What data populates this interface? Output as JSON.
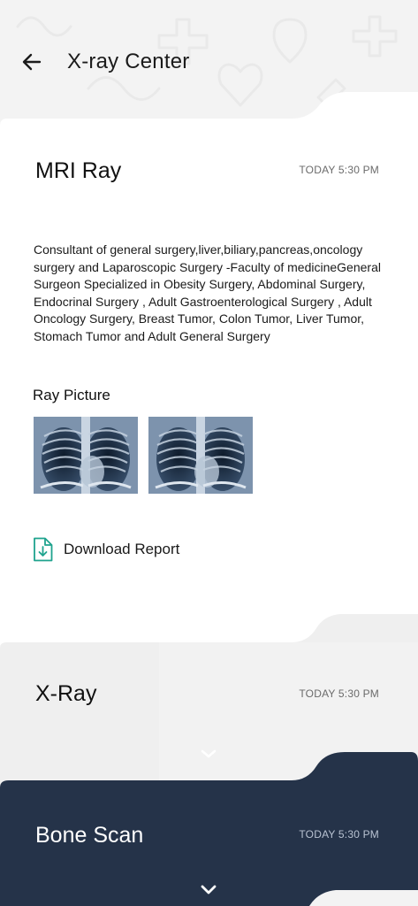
{
  "header": {
    "title": "X-ray Center"
  },
  "cards": {
    "mri": {
      "title": "MRI Ray",
      "time": "TODAY 5:30 PM",
      "description": "Consultant of general surgery,liver,biliary,pancreas,oncology surgery and Laparoscopic Surgery -Faculty of medicineGeneral Surgeon Specialized in Obesity Surgery, Abdominal Surgery, Endocrinal Surgery , Adult Gastroenterological Surgery , Adult Oncology Surgery, Breast Tumor, Colon Tumor, Liver Tumor, Stomach Tumor and Adult General Surgery",
      "pictures_label": "Ray Picture",
      "download_label": "Download Report"
    },
    "xray": {
      "title": "X-Ray",
      "time": "TODAY 5:30 PM"
    },
    "bone": {
      "title": "Bone Scan",
      "time": "TODAY 5:30 PM"
    }
  },
  "colors": {
    "accent": "#1fa38e",
    "navy": "#253349",
    "card_white": "#ffffff",
    "card_grey": "#efefef",
    "background": "#f3f3f3"
  },
  "icons": {
    "back": "arrow-left-icon",
    "download": "download-file-icon",
    "expand": "chevron-down-icon"
  }
}
